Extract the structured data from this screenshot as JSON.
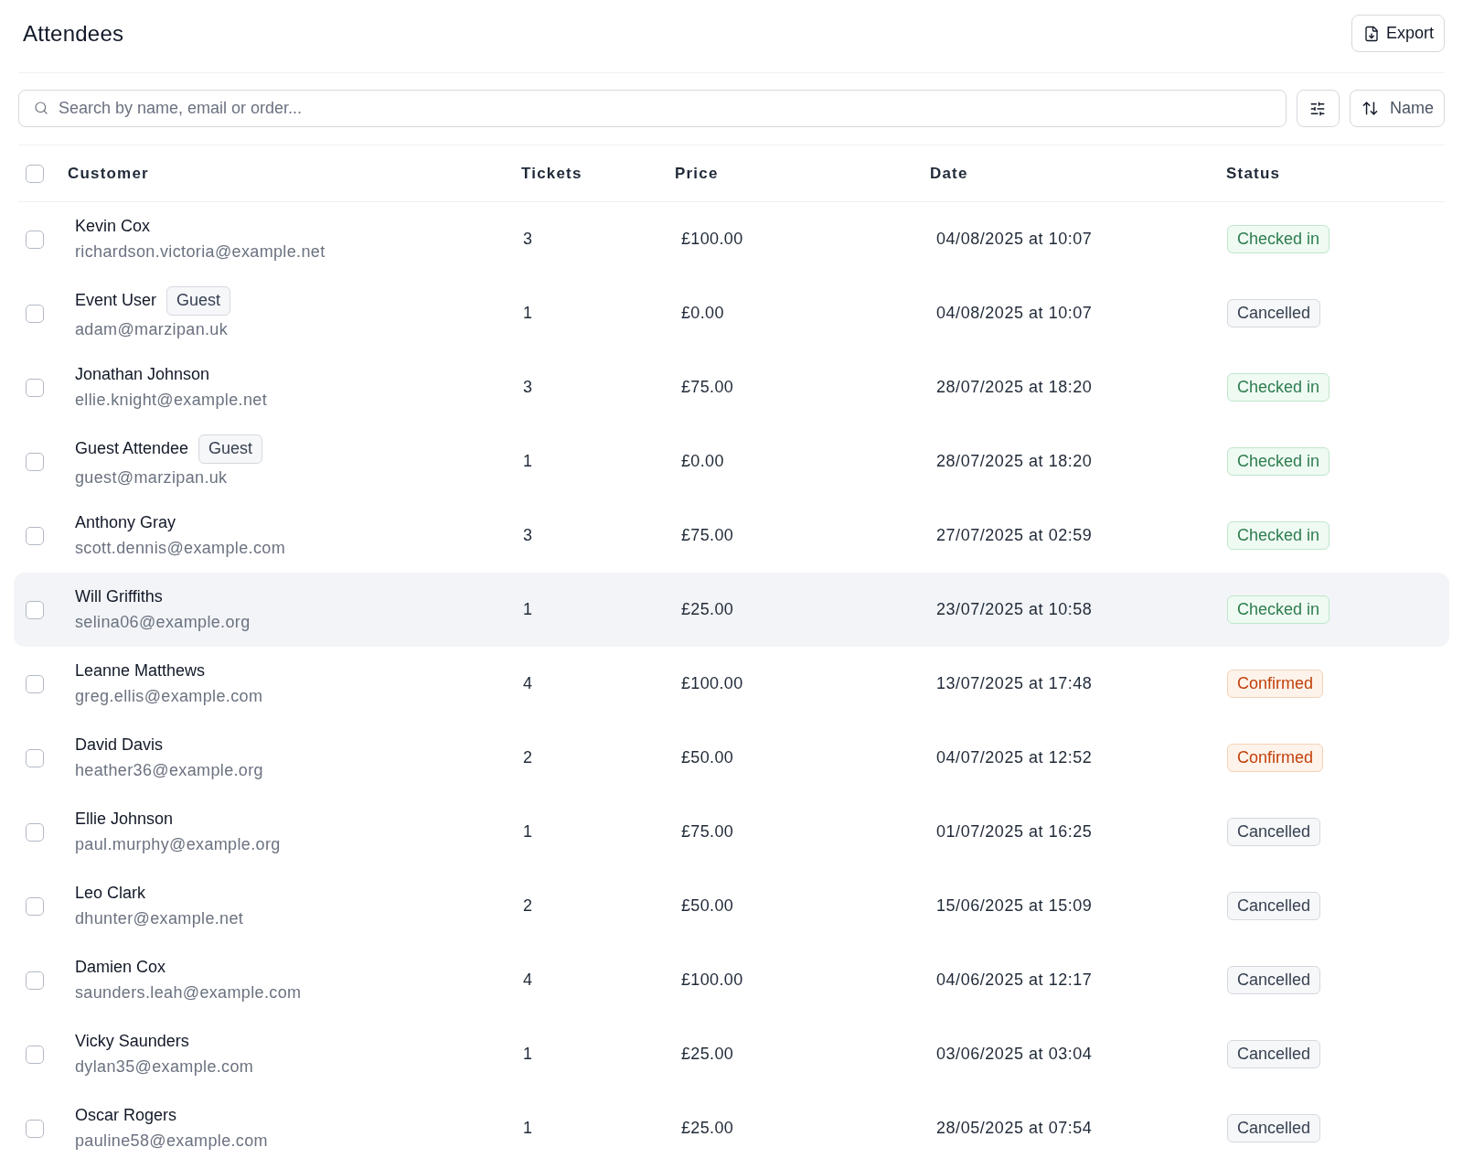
{
  "header": {
    "title": "Attendees",
    "export_button": "Export"
  },
  "toolbar": {
    "search": {
      "placeholder": "Search by name, email or order..."
    },
    "sort_button": "Name"
  },
  "table": {
    "select_all_checked": false,
    "columns": [
      "Customer",
      "Tickets",
      "Price",
      "Date",
      "Status"
    ],
    "rows": [
      {
        "name": "Kevin Cox",
        "email": "richardson.victoria@example.net",
        "tickets": "3",
        "price": "£100.00",
        "date": "04/08/2025 at 10:07",
        "status": {
          "kind": "checked_in",
          "label": "Checked in"
        },
        "checked": false,
        "hovered": false
      },
      {
        "name": "Event User",
        "badge": "Guest",
        "email": "adam@marzipan.uk",
        "tickets": "1",
        "price": "£0.00",
        "date": "04/08/2025 at 10:07",
        "status": {
          "kind": "cancelled",
          "label": "Cancelled"
        },
        "checked": false,
        "hovered": false
      },
      {
        "name": "Jonathan Johnson",
        "email": "ellie.knight@example.net",
        "tickets": "3",
        "price": "£75.00",
        "date": "28/07/2025 at 18:20",
        "status": {
          "kind": "checked_in",
          "label": "Checked in"
        },
        "checked": false,
        "hovered": false
      },
      {
        "name": "Guest Attendee",
        "badge": "Guest",
        "email": "guest@marzipan.uk",
        "tickets": "1",
        "price": "£0.00",
        "date": "28/07/2025 at 18:20",
        "status": {
          "kind": "checked_in",
          "label": "Checked in"
        },
        "checked": false,
        "hovered": false
      },
      {
        "name": "Anthony Gray",
        "email": "scott.dennis@example.com",
        "tickets": "3",
        "price": "£75.00",
        "date": "27/07/2025 at 02:59",
        "status": {
          "kind": "checked_in",
          "label": "Checked in"
        },
        "checked": false,
        "hovered": false
      },
      {
        "name": "Will Griffiths",
        "email": "selina06@example.org",
        "tickets": "1",
        "price": "£25.00",
        "date": "23/07/2025 at 10:58",
        "status": {
          "kind": "checked_in",
          "label": "Checked in"
        },
        "checked": false,
        "hovered": true
      },
      {
        "name": "Leanne Matthews",
        "email": "greg.ellis@example.com",
        "tickets": "4",
        "price": "£100.00",
        "date": "13/07/2025 at 17:48",
        "status": {
          "kind": "confirmed",
          "label": "Confirmed"
        },
        "checked": false,
        "hovered": false
      },
      {
        "name": "David Davis",
        "email": "heather36@example.org",
        "tickets": "2",
        "price": "£50.00",
        "date": "04/07/2025 at 12:52",
        "status": {
          "kind": "confirmed",
          "label": "Confirmed"
        },
        "checked": false,
        "hovered": false
      },
      {
        "name": "Ellie Johnson",
        "email": "paul.murphy@example.org",
        "tickets": "1",
        "price": "£75.00",
        "date": "01/07/2025 at 16:25",
        "status": {
          "kind": "cancelled",
          "label": "Cancelled"
        },
        "checked": false,
        "hovered": false
      },
      {
        "name": "Leo Clark",
        "email": "dhunter@example.net",
        "tickets": "2",
        "price": "£50.00",
        "date": "15/06/2025 at 15:09",
        "status": {
          "kind": "cancelled",
          "label": "Cancelled"
        },
        "checked": false,
        "hovered": false
      },
      {
        "name": "Damien Cox",
        "email": "saunders.leah@example.com",
        "tickets": "4",
        "price": "£100.00",
        "date": "04/06/2025 at 12:17",
        "status": {
          "kind": "cancelled",
          "label": "Cancelled"
        },
        "checked": false,
        "hovered": false
      },
      {
        "name": "Vicky Saunders",
        "email": "dylan35@example.com",
        "tickets": "1",
        "price": "£25.00",
        "date": "03/06/2025 at 03:04",
        "status": {
          "kind": "cancelled",
          "label": "Cancelled"
        },
        "checked": false,
        "hovered": false
      },
      {
        "name": "Oscar Rogers",
        "email": "pauline58@example.com",
        "tickets": "1",
        "price": "£25.00",
        "date": "28/05/2025 at 07:54",
        "status": {
          "kind": "cancelled",
          "label": "Cancelled"
        },
        "checked": false,
        "hovered": false
      }
    ]
  }
}
